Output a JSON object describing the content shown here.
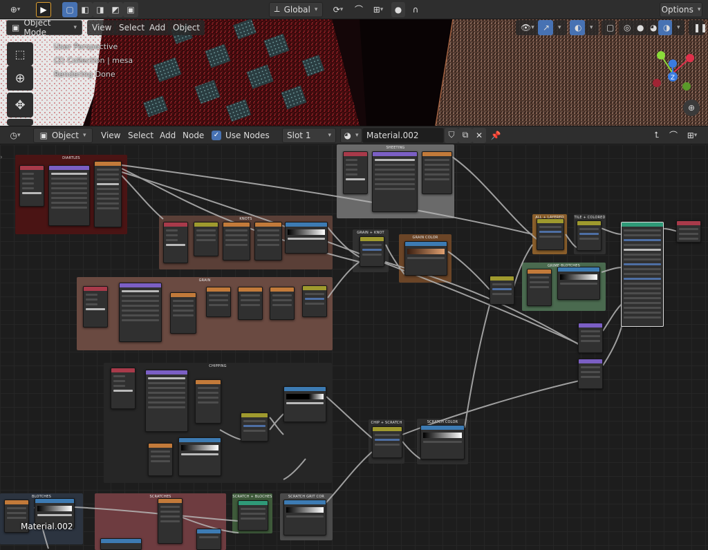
{
  "topbar": {
    "orientation_label": "Global",
    "options_label": "Options"
  },
  "viewport": {
    "mode_label": "Object Mode",
    "menu": [
      "View",
      "Select",
      "Add",
      "Object"
    ],
    "overlay_lines": [
      "User Perspective",
      "(2) Collection | mesa",
      "Rendering Done"
    ],
    "gizmo_z_label": "Z"
  },
  "node_editor": {
    "editor_type_label": "Object",
    "menu": [
      "View",
      "Select",
      "Add",
      "Node"
    ],
    "use_nodes_label": "Use Nodes",
    "use_nodes_checked": true,
    "slot_label": "Slot 1",
    "material_name": "Material.002",
    "canvas_material_label": "Material.002"
  },
  "frames": [
    {
      "title": "DIARTLES",
      "color": "#4a1414"
    },
    {
      "title": "SHEETING",
      "color": "#6a6a6a"
    },
    {
      "title": "KNOTS",
      "color": "#5a3f37"
    },
    {
      "title": "GRAIN + KNOT",
      "color": "#303030"
    },
    {
      "title": "GRAIN COLOR",
      "color": "#6b4527"
    },
    {
      "title": "GRAIN",
      "color": "#6a4a41"
    },
    {
      "title": "ALL + LAYERED",
      "color": "#8a5e2b"
    },
    {
      "title": "TILE + COLORED",
      "color": "#303030"
    },
    {
      "title": "GRIME BLOTCHES",
      "color": "#4a6a4f"
    },
    {
      "title": "CHIPPING",
      "color": "#262626"
    },
    {
      "title": "CHIP + SCRATCH",
      "color": "#2d2d2d"
    },
    {
      "title": "SCRATCH COLOR",
      "color": "#2d2d2d"
    },
    {
      "title": "BLOTCHES",
      "color": "#2c3440"
    },
    {
      "title": "SCRATCHES",
      "color": "#6e3c40"
    },
    {
      "title": "SCRATCH + BLOCHES",
      "color": "#3e5a3a"
    },
    {
      "title": "SCRATCH GRIT COR",
      "color": "#4a4a4a"
    }
  ],
  "colors": {
    "header_bar": "#2e2e2e",
    "selection_blue": "#4772b3",
    "node_header_purple": "#7b5fc4",
    "node_header_orange": "#c27a3a",
    "node_header_yellow": "#9f9a2e",
    "node_header_blue": "#3d7bb3",
    "node_header_teal": "#2f9a78",
    "node_header_red": "#a83a4a",
    "wire": "#b6b6b6"
  }
}
